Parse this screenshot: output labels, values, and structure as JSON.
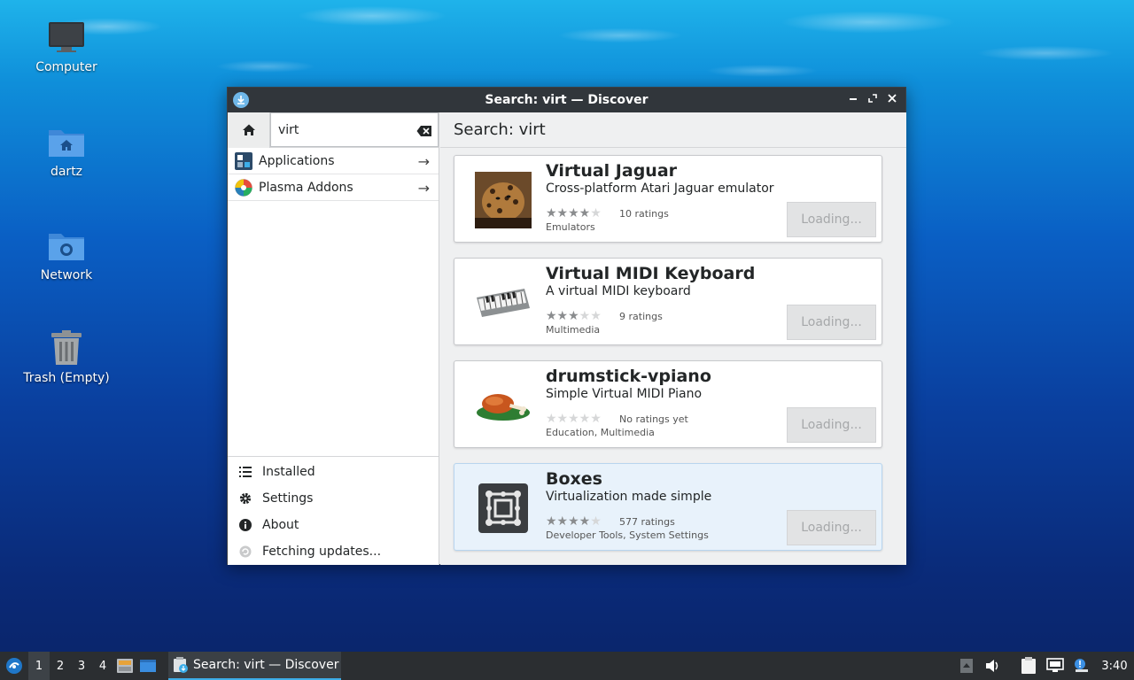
{
  "desktop": {
    "icons": [
      {
        "label": "Computer"
      },
      {
        "label": "dartz"
      },
      {
        "label": "Network"
      },
      {
        "label": "Trash (Empty)"
      }
    ]
  },
  "window": {
    "title": "Search: virt — Discover",
    "search": {
      "value": "virt"
    },
    "categories": [
      {
        "label": "Applications"
      },
      {
        "label": "Plasma Addons"
      }
    ],
    "bottom_nav": [
      {
        "label": "Installed",
        "icon": "list-icon"
      },
      {
        "label": "Settings",
        "icon": "gear-icon"
      },
      {
        "label": "About",
        "icon": "info-icon"
      },
      {
        "label": "Fetching updates...",
        "icon": "refresh-icon"
      }
    ],
    "header": "Search: virt",
    "results": [
      {
        "name": "Virtual Jaguar",
        "desc": "Cross-platform Atari Jaguar emulator",
        "rating_stars": 4,
        "ratings": "10 ratings",
        "cats": "Emulators",
        "button": "Loading..."
      },
      {
        "name": "Virtual MIDI Keyboard",
        "desc": "A virtual MIDI keyboard",
        "rating_stars": 3,
        "ratings": "9 ratings",
        "cats": "Multimedia",
        "button": "Loading..."
      },
      {
        "name": "drumstick-vpiano",
        "desc": "Simple Virtual MIDI Piano",
        "rating_stars": 0,
        "ratings": "No ratings yet",
        "cats": "Education, Multimedia",
        "button": "Loading..."
      },
      {
        "name": "Boxes",
        "desc": "Virtualization made simple",
        "rating_stars": 4,
        "ratings": "577 ratings",
        "cats": "Developer Tools, System Settings",
        "button": "Loading..."
      }
    ]
  },
  "taskbar": {
    "workspaces": [
      "1",
      "2",
      "3",
      "4"
    ],
    "task_label": "Search: virt — Discover",
    "clock": "3:40"
  },
  "colors": {
    "accent": "#3daee9",
    "titlebar": "#31363b",
    "highlight": "#e8f2fb"
  }
}
